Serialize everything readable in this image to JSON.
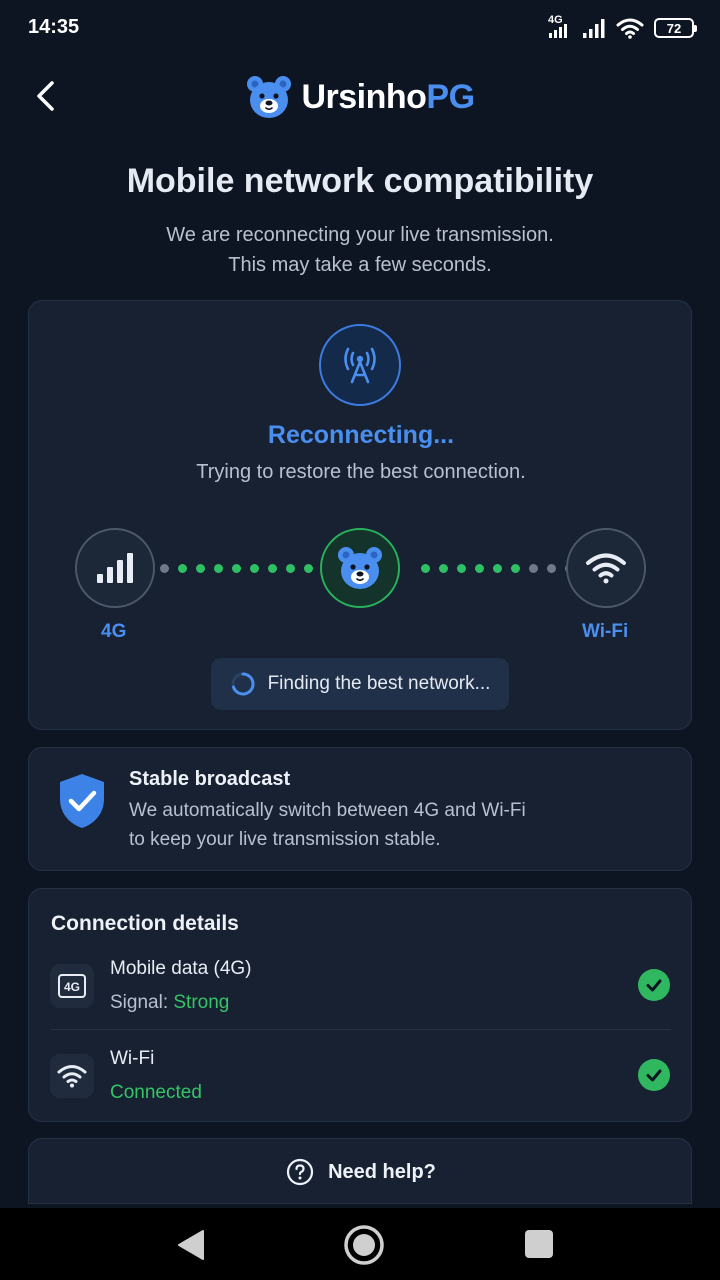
{
  "status_bar": {
    "time": "14:35",
    "network_type": "4G",
    "battery_level": "72",
    "icons": [
      "4g-icon",
      "signal-icon",
      "wifi-icon",
      "battery-icon"
    ]
  },
  "header": {
    "brand_first": "Ursinho",
    "brand_accent": "PG",
    "back_icon": "chevron-left-icon",
    "logo_icon": "bear-icon"
  },
  "page": {
    "title": "Mobile network compatibility",
    "subtitle_line1": "We are reconnecting your live transmission.",
    "subtitle_line2": "This may take a few seconds."
  },
  "reconnect": {
    "status_title": "Reconnecting...",
    "status_text": "Trying to restore the best connection.",
    "left_label": "4G",
    "right_label": "Wi-Fi",
    "finding_text": "Finding the best network...",
    "icons": [
      "tower-icon",
      "signal-bars-icon",
      "bear-icon",
      "wifi-icon",
      "spinner-icon"
    ]
  },
  "stable": {
    "title": "Stable broadcast",
    "text_line1": "We automatically switch between 4G and Wi-Fi",
    "text_line2": "to keep your live transmission stable.",
    "icon": "shield-check-icon"
  },
  "details": {
    "title": "Connection details",
    "rows": [
      {
        "name": "Mobile data (4G)",
        "status_prefix": "Signal: ",
        "status_value": "Strong",
        "icon_text": "4G"
      },
      {
        "name": "Wi-Fi",
        "status_prefix": "",
        "status_value": "Connected"
      }
    ]
  },
  "help": {
    "label": "Need help?",
    "icon": "question-circle-icon"
  },
  "colors": {
    "background": "#0e1522",
    "card": "#172131",
    "accent_blue": "#4a8ff0",
    "accent_green": "#2fc065",
    "text_muted": "#b8c0cf"
  }
}
